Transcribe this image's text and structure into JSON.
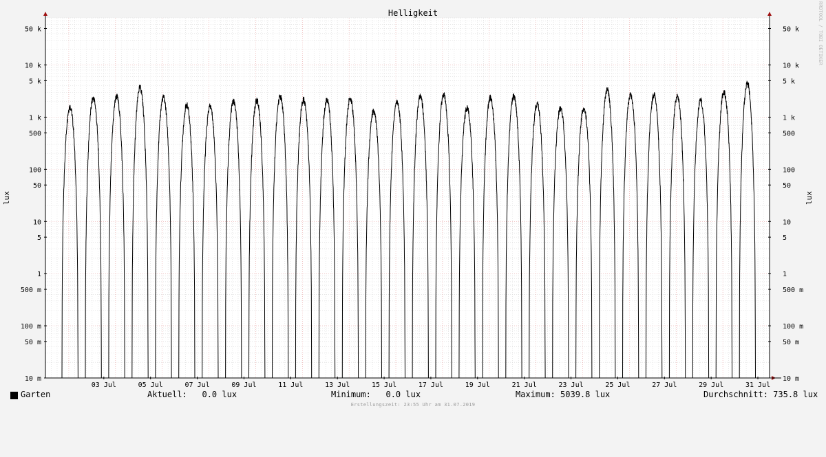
{
  "chart_data": {
    "type": "line",
    "title": "Helligkeit",
    "ylabel": "lux",
    "ylabel_right": "lux",
    "y_scale": "log",
    "ylim": [
      0.01,
      80000
    ],
    "y_ticks": [
      {
        "value": 50000,
        "label": "50 k"
      },
      {
        "value": 10000,
        "label": "10 k"
      },
      {
        "value": 5000,
        "label": "5 k"
      },
      {
        "value": 1000,
        "label": "1 k"
      },
      {
        "value": 500,
        "label": "500"
      },
      {
        "value": 100,
        "label": "100"
      },
      {
        "value": 50,
        "label": "50"
      },
      {
        "value": 10,
        "label": "10"
      },
      {
        "value": 5,
        "label": "5"
      },
      {
        "value": 1,
        "label": "1"
      },
      {
        "value": 0.5,
        "label": "500 m"
      },
      {
        "value": 0.1,
        "label": "100 m"
      },
      {
        "value": 0.05,
        "label": "50 m"
      },
      {
        "value": 0.01,
        "label": "10 m"
      }
    ],
    "x_ticks": [
      "03 Jul",
      "05 Jul",
      "07 Jul",
      "09 Jul",
      "11 Jul",
      "13 Jul",
      "15 Jul",
      "17 Jul",
      "19 Jul",
      "21 Jul",
      "23 Jul",
      "25 Jul",
      "27 Jul",
      "29 Jul",
      "31 Jul"
    ],
    "x_start": "01 Jul",
    "x_end": "01 Aug",
    "grid": true,
    "colors": {
      "line": "#000000",
      "major_grid": "#e8a0a0",
      "minor_grid": "#d8d8d8",
      "background": "#ffffff",
      "page": "#f3f3f3",
      "arrow": "#a01010"
    },
    "series": [
      {
        "name": "Garten",
        "daily_peaks": [
          1600,
          2300,
          2500,
          3700,
          2400,
          1700,
          1600,
          2000,
          2100,
          2500,
          2200,
          2200,
          2300,
          1300,
          2000,
          2500,
          2700,
          1500,
          2400,
          2500,
          1800,
          1500,
          1500,
          3400,
          2700,
          2700,
          2500,
          2100,
          3100,
          4400
        ],
        "summary": {
          "aktuell": 0.0,
          "minimum": 0.0,
          "maximum": 5039.8,
          "durchschnitt": 735.8,
          "unit": "lux"
        }
      }
    ]
  },
  "legend": {
    "series_name": "Garten",
    "aktuell": "Aktuell:   0.0 lux",
    "minimum": "Minimum:   0.0 lux",
    "maximum": "Maximum: 5039.8 lux",
    "durchschnitt": "Durchschnitt: 735.8 lux"
  },
  "footer": "Erstellungszeit: 23:55 Uhr am 31.07.2019",
  "watermark": "RRDTOOL / TOBI OETIKER"
}
